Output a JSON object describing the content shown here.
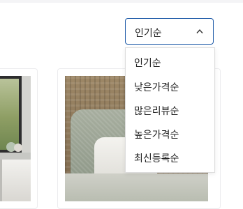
{
  "sort_dropdown": {
    "selected": "인기순",
    "options": [
      "인기순",
      "낮은가격순",
      "많은리뷰순",
      "높은가격순",
      "최신등록순"
    ],
    "expanded": true,
    "accent_color": "#1f5ba8",
    "toggle_icon": "chevron-up-icon"
  },
  "products": [
    {
      "image": "window-desk-photo"
    },
    {
      "image": "pillows-headboard-photo"
    }
  ]
}
